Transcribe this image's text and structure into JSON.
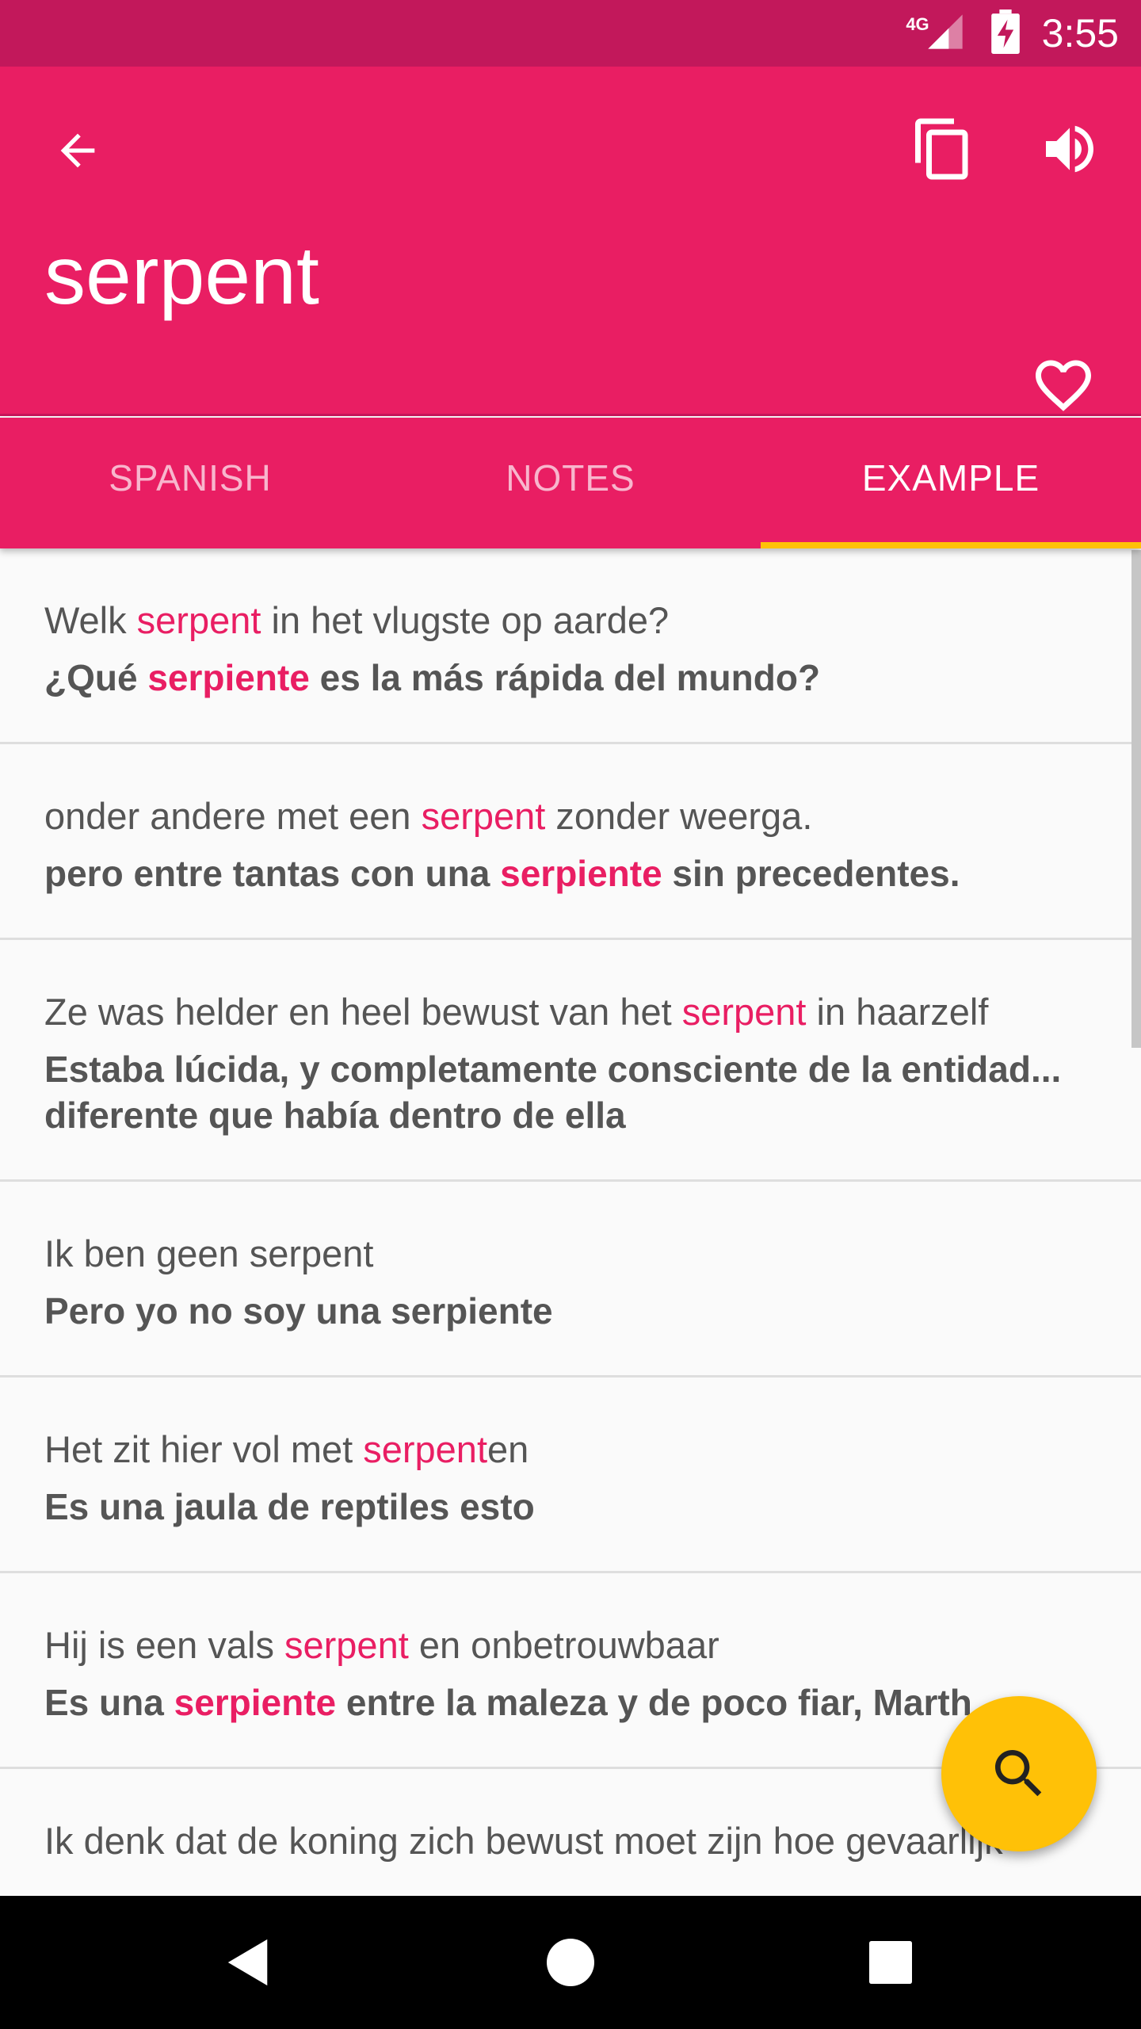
{
  "status_bar": {
    "network_type": "4G",
    "time": "3:55"
  },
  "app_bar": {
    "title": "serpent",
    "icons": [
      "arrow-back-icon",
      "copy-icon",
      "volume-up-icon",
      "heart-outline-icon"
    ]
  },
  "tabs": [
    {
      "label": "SPANISH",
      "active": false
    },
    {
      "label": "NOTES",
      "active": false
    },
    {
      "label": "EXAMPLE",
      "active": true
    }
  ],
  "examples": [
    {
      "dutch": [
        {
          "t": "Welk "
        },
        {
          "t": "serpent",
          "hl": true
        },
        {
          "t": " in het vlugste op aarde?"
        }
      ],
      "spanish": [
        {
          "t": "¿Qué "
        },
        {
          "t": "serpiente",
          "hl": true
        },
        {
          "t": " es la más rápida del mundo?"
        }
      ]
    },
    {
      "dutch": [
        {
          "t": "onder andere met een "
        },
        {
          "t": "serpent",
          "hl": true
        },
        {
          "t": " zonder weerga."
        }
      ],
      "spanish": [
        {
          "t": "pero entre tantas con una "
        },
        {
          "t": "serpiente",
          "hl": true
        },
        {
          "t": " sin precedentes."
        }
      ]
    },
    {
      "dutch": [
        {
          "t": "Ze was helder en heel bewust van het "
        },
        {
          "t": "serpent",
          "hl": true
        },
        {
          "t": " in haarzelf"
        }
      ],
      "spanish": [
        {
          "t": "Estaba lúcida, y completamente consciente de la entidad... diferente que había dentro de ella"
        }
      ]
    },
    {
      "dutch": [
        {
          "t": "Ik ben geen serpent"
        }
      ],
      "spanish": [
        {
          "t": "Pero yo no soy una serpiente"
        }
      ]
    },
    {
      "dutch": [
        {
          "t": "Het zit hier vol met "
        },
        {
          "t": "serpent",
          "hl": true
        },
        {
          "t": "en"
        }
      ],
      "spanish": [
        {
          "t": "Es una jaula de reptiles esto"
        }
      ]
    },
    {
      "dutch": [
        {
          "t": "Hij is een vals "
        },
        {
          "t": "serpent",
          "hl": true
        },
        {
          "t": " en onbetrouwbaar"
        }
      ],
      "spanish": [
        {
          "t": "Es una "
        },
        {
          "t": "serpiente",
          "hl": true
        },
        {
          "t": " entre la maleza y de poco fiar, Marth"
        }
      ]
    },
    {
      "dutch": [
        {
          "t": "Ik denk dat de koning zich bewust moet zijn hoe gevaarlijk"
        }
      ],
      "spanish": []
    }
  ],
  "fab": {
    "icon": "search-icon"
  },
  "nav_bar": {
    "icons": [
      "back-triangle-icon",
      "home-circle-icon",
      "recents-square-icon"
    ]
  },
  "colors": {
    "status_bar": "#c2185b",
    "primary": "#e91e63",
    "accent": "#ffc107",
    "text": "#555555"
  }
}
